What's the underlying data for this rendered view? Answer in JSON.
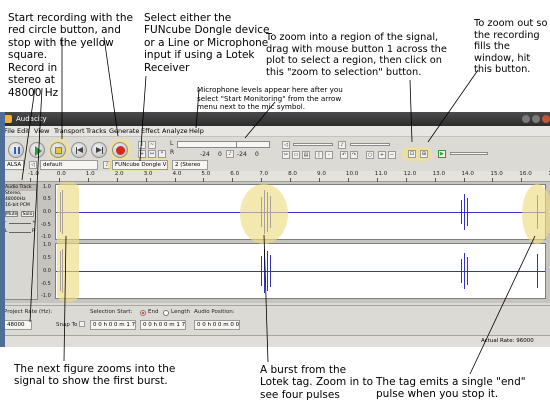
{
  "annotations": {
    "start_recording": "Start recording with the red circle button, and stop with the yellow square.",
    "record_stereo": "Record in stereo at 48000 Hz",
    "select_dongle": "Select either the FUNcube Dongle device or a Line or Microphone input if using a Lotek Receiver",
    "mic_levels": "Microphone levels appear here after you select \"Start Monitoring\" from the arrow menu next to the mic symbol.",
    "zoom_region": "To zoom into a region of the signal, drag with mouse button 1 across the plot to select a region, then click on this \"zoom to selection\" button.",
    "zoom_out": "To zoom out so the recording fills the window, hit this button.",
    "next_figure": "The next figure zooms into the signal to show the first burst.",
    "burst": "A burst from the Lotek tag.  Zoom in to see four pulses",
    "end_pulse": "The tag emits a single \"end\" pulse when you stop it."
  },
  "window": {
    "title": "Audacity"
  },
  "menu": [
    "File",
    "Edit",
    "View",
    "Transport",
    "Tracks",
    "Generate",
    "Effect",
    "Analyze",
    "Help"
  ],
  "device_toolbar": {
    "host": "ALSA",
    "output_device": "default",
    "input_device": "FUNcube Dongle V",
    "channels": "2 (Stereo"
  },
  "meters": {
    "left_label": "L",
    "right_label": "R",
    "db_1": "-24",
    "db_2": "0",
    "db_3": "-24",
    "db_4": "0"
  },
  "ruler": {
    "ticks": [
      "-1.0",
      "0.0",
      "1.0",
      "2.0",
      "3.0",
      "4.0",
      "5.0",
      "6.0",
      "7.0",
      "8.0",
      "9.0",
      "10.0",
      "11.0",
      "12.0",
      "13.0",
      "14.0",
      "15.0",
      "16.0",
      "17.0"
    ]
  },
  "track": {
    "name": "Audio Track",
    "info_line1": "Stereo, 48000Hz",
    "info_line2": "16-bit PCM",
    "mute": "Mute",
    "solo": "Solo",
    "gain_minus": "-",
    "gain_plus": "+",
    "pan_left": "L",
    "pan_right": "R",
    "y_top": "1.0",
    "y_mid_top": "0.5",
    "y_zero": "0.0",
    "y_mid_bottom": "-0.5",
    "y_bottom": "-1.0"
  },
  "selection_toolbar": {
    "project_rate_label": "Project Rate (Hz):",
    "project_rate": "48000",
    "snap_to": "Snap To",
    "selection_start_label": "Selection Start:",
    "end_label": "End",
    "length_label": "Length",
    "audio_position_label": "Audio Position:",
    "selection_start_value": "0 0 h 0 0 m 1 7 s",
    "end_value": "0 0 h 0 0 m 1 7 s",
    "audio_position_value": "0 0 h 0 0 m 0 0 s"
  },
  "status": {
    "actual_rate": "Actual Rate: 96000"
  },
  "colors": {
    "waveform": "#3232c8",
    "highlight": "#ece09a",
    "record_red": "#d42a1e",
    "stop_yellow": "#e2c93a"
  }
}
